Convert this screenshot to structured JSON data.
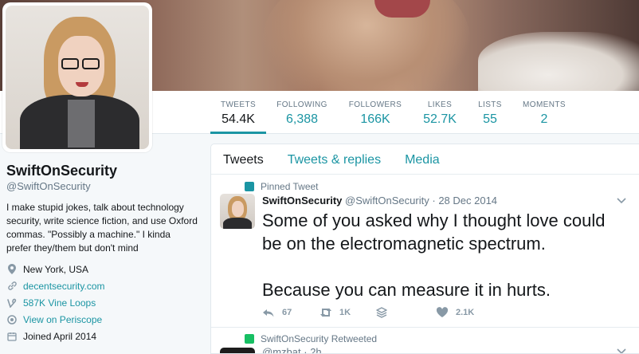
{
  "nav": {
    "stats": [
      {
        "label": "TWEETS",
        "value": "54.4K"
      },
      {
        "label": "FOLLOWING",
        "value": "6,388"
      },
      {
        "label": "FOLLOWERS",
        "value": "166K"
      },
      {
        "label": "LIKES",
        "value": "52.7K"
      },
      {
        "label": "LISTS",
        "value": "55"
      },
      {
        "label": "MOMENTS",
        "value": "2"
      }
    ]
  },
  "profile": {
    "name": "SwiftOnSecurity",
    "handle": "@SwiftOnSecurity",
    "bio": "I make stupid jokes, talk about technology security, write science fiction, and use Oxford commas. \"Possibly a machine.\" I kinda prefer they/them but don't mind",
    "location": "New York, USA",
    "website": "decentsecurity.com",
    "vine": "587K Vine Loops",
    "periscope": "View on Periscope",
    "joined": "Joined April 2014"
  },
  "timeline": {
    "tabs": [
      {
        "label": "Tweets"
      },
      {
        "label": "Tweets & replies"
      },
      {
        "label": "Media"
      }
    ],
    "pinned": {
      "context": "Pinned Tweet",
      "name": "SwiftOnSecurity",
      "handle": "@SwiftOnSecurity",
      "dot": "·",
      "date": "28 Dec 2014",
      "text1": "Some of you asked why I thought love could be on the electromagnetic spectrum.",
      "text2": "Because you can measure it in hurts.",
      "replies": "67",
      "retweets": "1K",
      "likes": "2.1K"
    },
    "retweet": {
      "context": "SwiftOnSecurity Retweeted",
      "handle": "@mzbat",
      "dot": "·",
      "date": "2h"
    }
  },
  "colors": {
    "accent": "#1b95a3",
    "muted": "#657786",
    "border": "#e1e8ed"
  }
}
